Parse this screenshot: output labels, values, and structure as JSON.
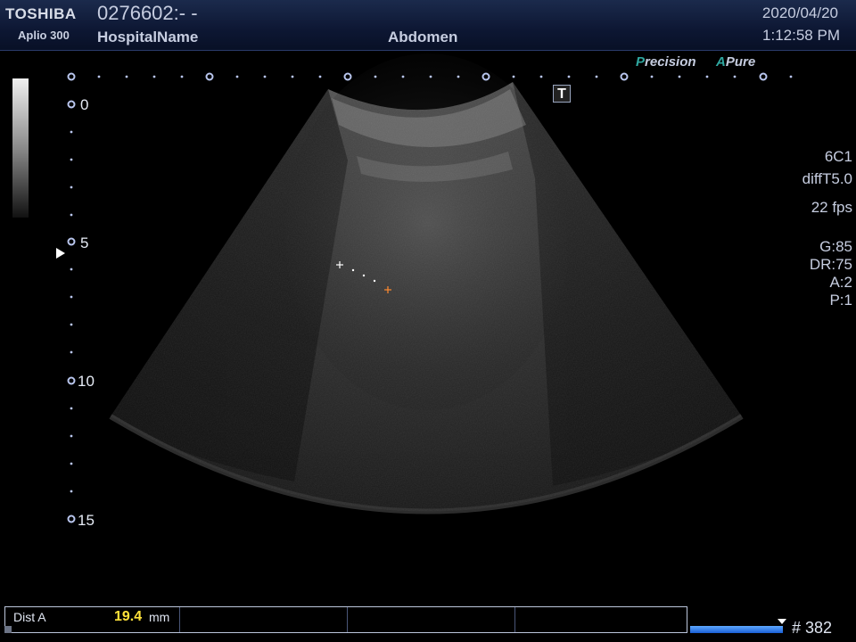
{
  "header": {
    "brand": "TOSHIBA",
    "model": "Aplio 300",
    "patient_id": "0276602:- -",
    "hospital_name": "HospitalName",
    "exam_preset": "Abdomen",
    "date": "2020/04/20",
    "time": "1:12:58 PM"
  },
  "logos": {
    "precision_first": "P",
    "precision_rest": "recision",
    "apure_first": "A",
    "apure_rest": "Pure",
    "accent_color": "#2fa7a0"
  },
  "marker": {
    "label": "T"
  },
  "params": {
    "probe": "6C1",
    "mode": "diffT5.0",
    "frame_rate": "22 fps",
    "gain": "G:85",
    "dynamic_range": "DR:75",
    "a_param": "A:2",
    "p_param": "P:1"
  },
  "depth_scale": {
    "labels": [
      "0",
      "5",
      "10",
      "15"
    ],
    "unit": "cm"
  },
  "measurement": {
    "label": "Dist A",
    "value": "19.4",
    "unit": "mm",
    "caliper_start_color": "#ffffff",
    "caliper_end_color": "#ff8a30"
  },
  "cine": {
    "frame": "# 382"
  }
}
